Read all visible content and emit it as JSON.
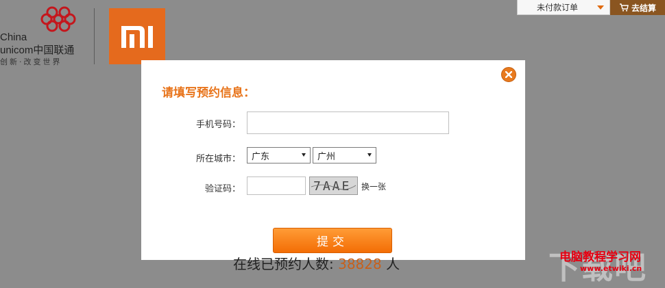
{
  "header": {
    "unicom_line1": "China",
    "unicom_line2": "unicom中国联通",
    "unicom_slogan": "创新·改变世界",
    "mi_logo_icon": "mi-logo"
  },
  "topbar": {
    "orders_label": "未付款订单",
    "checkout_label": "去结算",
    "cart_icon": "cart-icon"
  },
  "modal": {
    "title": "请填写预约信息：",
    "phone_label": "手机号码：",
    "phone_value": "",
    "city_label": "所在城市：",
    "province_selected": "广东",
    "city_selected": "广州",
    "captcha_label": "验证码：",
    "captcha_value": "",
    "captcha_text": "7AAE",
    "refresh_label": "换一张",
    "submit_label": "提交",
    "close_icon": "close-icon"
  },
  "footer": {
    "online_label": "在线已预约人数:",
    "online_count": "38828",
    "online_suffix": "人"
  },
  "watermark": {
    "site_name": "电脑教程学习网",
    "url": "www.etwiki.cn",
    "bg_text": "下载吧"
  },
  "colors": {
    "accent": "#e8741b",
    "mi_orange": "#e56a1d",
    "overlay": "#8c8c8c"
  }
}
